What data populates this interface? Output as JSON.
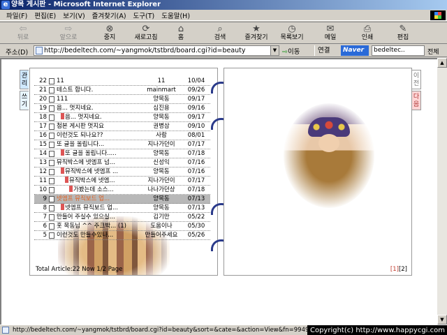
{
  "window": {
    "title": "양목 게시판 - Microsoft Internet Explorer"
  },
  "menu": [
    "파일(F)",
    "편집(E)",
    "보기(V)",
    "즐겨찾기(A)",
    "도구(T)",
    "도움말(H)"
  ],
  "toolbar": {
    "back": "뒤로",
    "forward": "앞으로",
    "stop": "중지",
    "refresh": "새로고침",
    "home": "홈",
    "search": "검색",
    "favorites": "즐겨찾기",
    "history": "목록보기",
    "mail": "메일",
    "print": "인쇄",
    "edit": "편집"
  },
  "address": {
    "label": "주소(D)",
    "url": "http://bedeltech.com/~yangmok/tstbrd/board.cgi?id=beauty",
    "go": "이동",
    "links": "연결",
    "naver": "Naver",
    "naver_value": "bedeltec..",
    "all": "전체"
  },
  "tabs": {
    "admin": "관리",
    "write": "쓰기",
    "prev": "이전",
    "next": "다음"
  },
  "board": {
    "rows": [
      {
        "num": "22",
        "title": "11",
        "author": "11",
        "date": "10/04",
        "reply": 0
      },
      {
        "num": "21",
        "title": "테스트 합니다.",
        "author": "mainmart",
        "date": "09/26",
        "reply": 0
      },
      {
        "num": "20",
        "title": "111",
        "author": "양목동",
        "date": "09/17",
        "reply": 0
      },
      {
        "num": "19",
        "title": "음... 멋지네요.",
        "author": "심진용",
        "date": "09/16",
        "reply": 0
      },
      {
        "num": "18",
        "title": "음... 멋지네요.",
        "author": "양목동",
        "date": "09/17",
        "reply": 1
      },
      {
        "num": "17",
        "title": "첨본 게시판 멋지요",
        "author": "권병삼",
        "date": "09/10",
        "reply": 0
      },
      {
        "num": "16",
        "title": "이런것도 되나요??",
        "author": "사람",
        "date": "08/01",
        "reply": 0
      },
      {
        "num": "15",
        "title": "또 글을 올립니다...",
        "author": "지나가던이",
        "date": "07/17",
        "reply": 0
      },
      {
        "num": "14",
        "title": "또 글을 올립니다.....",
        "author": "양목동",
        "date": "07/18",
        "reply": 1
      },
      {
        "num": "13",
        "title": "뮤직박스에 넷엠프 넘...",
        "author": "신성익",
        "date": "07/16",
        "reply": 0
      },
      {
        "num": "12",
        "title": "뮤직박스에 넷엠프 ...",
        "author": "양목동",
        "date": "07/16",
        "reply": 1
      },
      {
        "num": "11",
        "title": "뮤직박스에 넷엠...",
        "author": "지나가던이",
        "date": "07/17",
        "reply": 2
      },
      {
        "num": "10",
        "title": "가봤는데 소스...",
        "author": "나나가던상",
        "date": "07/18",
        "reply": 3
      },
      {
        "num": "9",
        "title": "넷엠프 뮤직보드 업...",
        "author": "양목동",
        "date": "07/13",
        "reply": 0
      },
      {
        "num": "8",
        "title": "넷엠프 뮤직보드 업...",
        "author": "양목동",
        "date": "07/13",
        "reply": 1
      },
      {
        "num": "7",
        "title": "만들어 주실수 있으실...",
        "author": "김기만",
        "date": "05/22",
        "reply": 0
      },
      {
        "num": "6",
        "title": "홋 목동님 ^^ 주크박... (1)",
        "author": "도움이나",
        "date": "05/30",
        "reply": 0
      },
      {
        "num": "5",
        "title": "이런것도 만들수있나...",
        "author": "만들어주세요",
        "date": "05/26",
        "reply": 0
      }
    ],
    "footer": "Total Article:22 Now 1/2 Page"
  },
  "pager": {
    "p1": "[1]",
    "p2": "[2]"
  },
  "status": {
    "url": "http://bedeltech.com/~yangmok/tstbrd/board.cgi?id=beauty&sort=&cate=&action=View&fn=994950621&",
    "copyright": "Copyright(c) http://www.happycgi.com"
  }
}
